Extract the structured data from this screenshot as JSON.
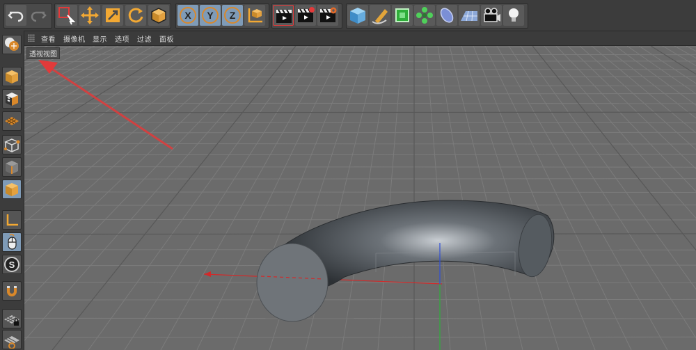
{
  "viewport": {
    "label": "透视视图"
  },
  "menubar": {
    "items": [
      "查看",
      "摄像机",
      "显示",
      "选项",
      "过滤",
      "面板"
    ]
  },
  "toolbar": {
    "axis_x_label": "X",
    "axis_y_label": "Y",
    "axis_z_label": "Z",
    "snap_label": "S"
  },
  "colors": {
    "accent_orange": "#d9882a",
    "arrow_red": "#e23a3a",
    "axis_x": "#d22a2a",
    "axis_y": "#2fae3a",
    "axis_z": "#2f4fd8",
    "active_blue": "#7f9bb7"
  },
  "icons": {
    "undo": "undo-icon",
    "redo": "redo-icon",
    "select": "live-selection-icon",
    "move": "move-icon",
    "scale": "scale-icon",
    "rotate": "rotate-icon",
    "render": "clapboard-icon"
  }
}
